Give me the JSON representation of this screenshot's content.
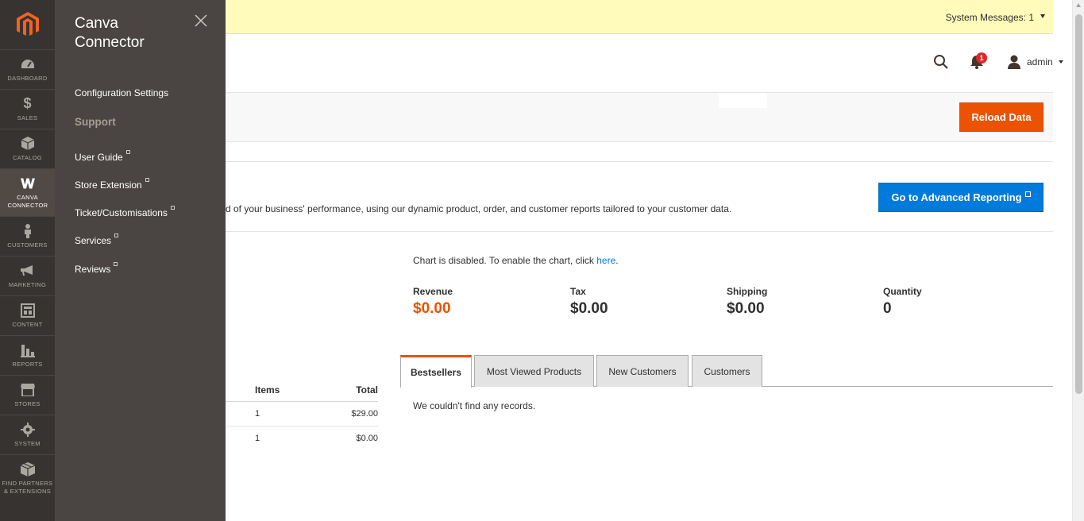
{
  "nav": {
    "items": [
      {
        "label": "DASHBOARD",
        "icon": "dashboard-icon"
      },
      {
        "label": "SALES",
        "icon": "dollar-icon"
      },
      {
        "label": "CATALOG",
        "icon": "box-icon"
      },
      {
        "label": "CANVA CONNECTOR",
        "icon": "canva-w-icon"
      },
      {
        "label": "CUSTOMERS",
        "icon": "person-icon"
      },
      {
        "label": "MARKETING",
        "icon": "megaphone-icon"
      },
      {
        "label": "CONTENT",
        "icon": "layout-icon"
      },
      {
        "label": "REPORTS",
        "icon": "bar-chart-icon"
      },
      {
        "label": "STORES",
        "icon": "storefront-icon"
      },
      {
        "label": "SYSTEM",
        "icon": "gear-icon"
      },
      {
        "label": "FIND PARTNERS & EXTENSIONS",
        "icon": "package-icon"
      }
    ],
    "active": "CANVA CONNECTOR"
  },
  "submenu": {
    "title": "Canva Connector",
    "config_link": "Configuration Settings",
    "section": "Support",
    "links": [
      "User Guide",
      "Store Extension",
      "Ticket/Customisations",
      "Services",
      "Reviews"
    ]
  },
  "system_messages": "System Messages: 1",
  "header": {
    "notification_count": "1",
    "user": "admin"
  },
  "toolbar": {
    "reload_label": "Reload Data"
  },
  "advanced": {
    "text": "d of your business' performance, using our dynamic product, order, and customer reports tailored to your customer data.",
    "button_label": "Go to Advanced Reporting"
  },
  "chart": {
    "message": "Chart is disabled. To enable the chart, click ",
    "link": "here",
    "suffix": "."
  },
  "totals": [
    {
      "label": "Revenue",
      "value": "$0.00"
    },
    {
      "label": "Tax",
      "value": "$0.00"
    },
    {
      "label": "Shipping",
      "value": "$0.00"
    },
    {
      "label": "Quantity",
      "value": "0"
    }
  ],
  "orders": {
    "headers": [
      "Items",
      "Total"
    ],
    "rows": [
      {
        "items": "1",
        "total": "$29.00"
      },
      {
        "items": "1",
        "total": "$0.00"
      }
    ]
  },
  "tabs": {
    "items": [
      "Bestsellers",
      "Most Viewed Products",
      "New Customers",
      "Customers"
    ],
    "active": "Bestsellers",
    "empty_message": "We couldn't find any records."
  },
  "colors": {
    "accent": "#eb5202",
    "link": "#007bdb",
    "nav_bg": "#373330",
    "submenu_bg": "#4a4542"
  }
}
